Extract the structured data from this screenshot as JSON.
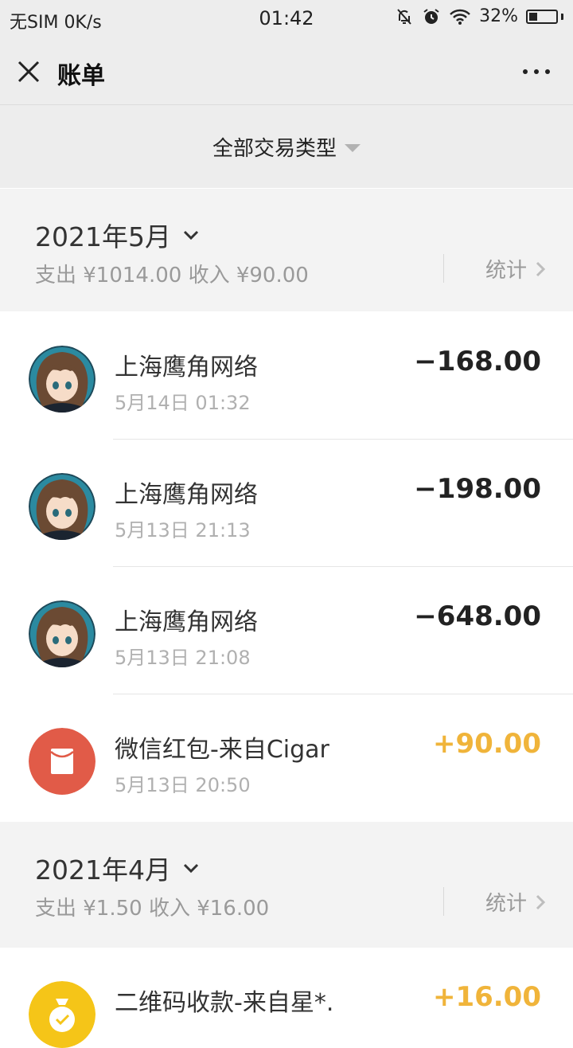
{
  "status_bar": {
    "carrier": "无SIM",
    "speed": "0K/s",
    "time": "01:42",
    "battery": "32%",
    "battery_level": 0.32
  },
  "nav": {
    "title": "账单"
  },
  "filter": {
    "label": "全部交易类型"
  },
  "months": [
    {
      "title": "2021年5月",
      "summary": "支出 ¥1014.00 收入 ¥90.00",
      "stat_label": "统计",
      "transactions": [
        {
          "name": "上海鹰角网络",
          "time": "5月14日 01:32",
          "amount": "−168.00",
          "type": "expense",
          "icon": "avatar-anime-icon"
        },
        {
          "name": "上海鹰角网络",
          "time": "5月13日 21:13",
          "amount": "−198.00",
          "type": "expense",
          "icon": "avatar-anime-icon"
        },
        {
          "name": "上海鹰角网络",
          "time": "5月13日 21:08",
          "amount": "−648.00",
          "type": "expense",
          "icon": "avatar-anime-icon"
        },
        {
          "name": "微信红包-来自Cigar",
          "time": "5月13日 20:50",
          "amount": "+90.00",
          "type": "income",
          "icon": "red-packet-icon"
        }
      ]
    },
    {
      "title": "2021年4月",
      "summary": "支出 ¥1.50 收入 ¥16.00",
      "stat_label": "统计",
      "transactions": [
        {
          "name": "二维码收款-来自星*.",
          "time": "",
          "amount": "+16.00",
          "type": "income",
          "icon": "money-bag-icon"
        }
      ]
    }
  ],
  "colors": {
    "income": "#f0b43a",
    "red_packet": "#e15b48",
    "money_bag": "#f5c518",
    "background_gray": "#ededed"
  }
}
